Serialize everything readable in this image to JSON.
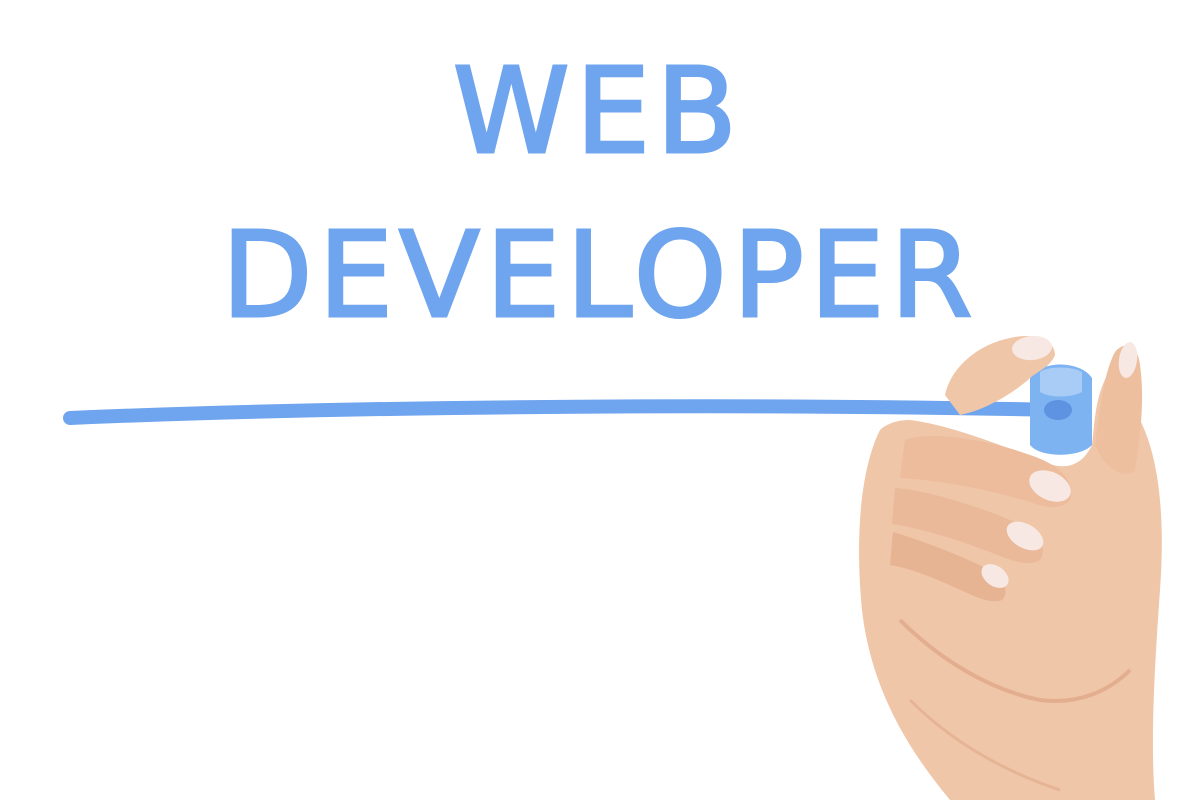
{
  "board": {
    "line1": "WEB",
    "line2": "DEVELOPER"
  },
  "colors": {
    "ink": "#6fa4ee",
    "background": "#ffffff",
    "skin": "#f0c6a8",
    "skin_shadow": "#d99e7e",
    "nail": "#f7e8e4",
    "marker_cap": "#7eb3f2"
  },
  "icons": {
    "hand": "hand-holding-marker",
    "marker": "blue-marker"
  }
}
